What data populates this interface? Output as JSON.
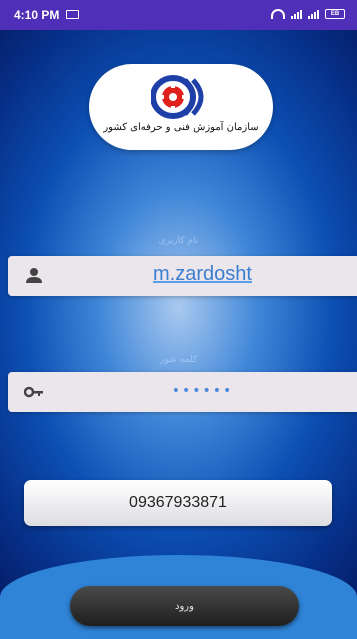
{
  "status_bar": {
    "time": "4:10 PM",
    "battery": "EB"
  },
  "logo": {
    "org_name": "سازمان آموزش فنی و حرفه‌ای کشور",
    "colors": {
      "blue": "#1f3fa8",
      "red": "#e0201a"
    }
  },
  "login_form": {
    "username_label": "نام کاربری",
    "username_value": "m.zardosht",
    "password_label": "کلمه عبور",
    "password_value": "••••••",
    "phone_button_label": "09367933871",
    "login_button_label": "ورود"
  },
  "icons": {
    "username": "person-icon",
    "password": "key-icon"
  }
}
